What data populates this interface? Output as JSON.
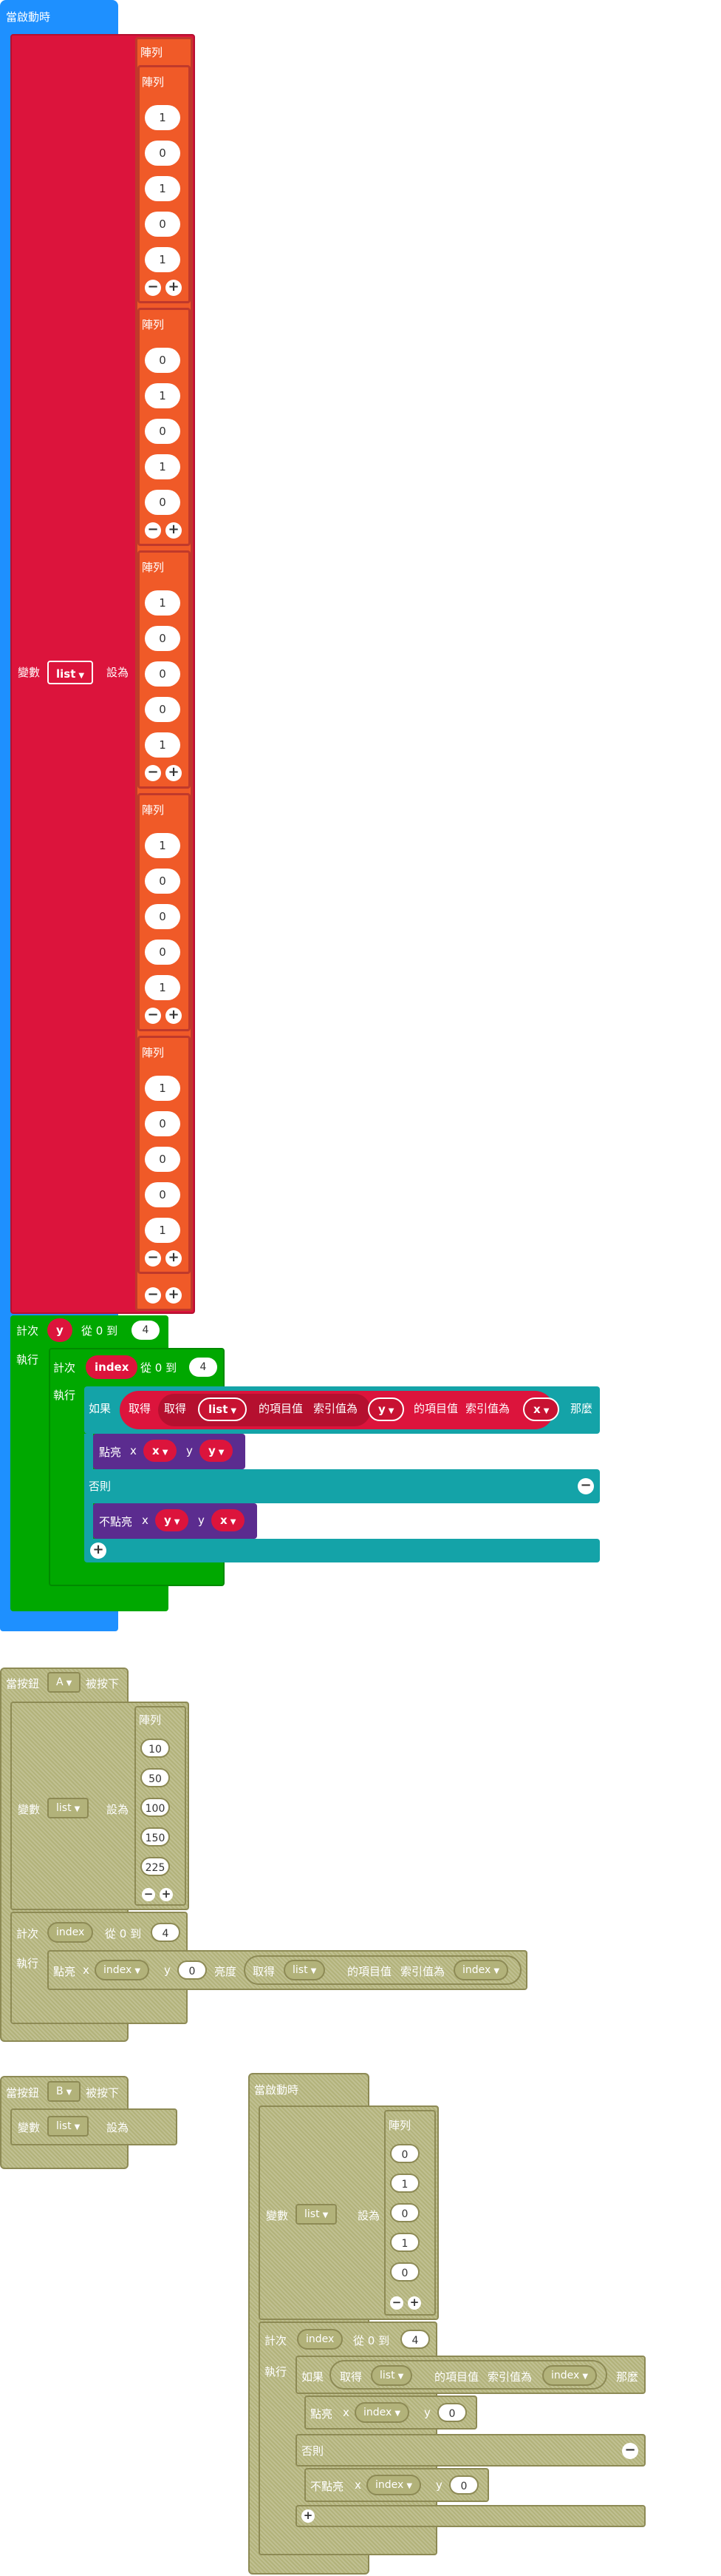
{
  "colors": {
    "start": "#1e90ff",
    "variables": "#dc143c",
    "array": "#f05a28",
    "loops": "#00a800",
    "logic": "#14a3a8",
    "led": "#5b2c8f",
    "disabled": "#b2b27a"
  },
  "stack1": {
    "hat": "當啟動時",
    "set_label": "變數",
    "var_name": "list",
    "set_to": "設為",
    "array_label": "陣列",
    "rows": [
      {
        "label": "陣列",
        "values": [
          "1",
          "0",
          "1",
          "0",
          "1"
        ]
      },
      {
        "label": "陣列",
        "values": [
          "0",
          "1",
          "0",
          "1",
          "0"
        ]
      },
      {
        "label": "陣列",
        "values": [
          "1",
          "0",
          "0",
          "0",
          "1"
        ]
      },
      {
        "label": "陣列",
        "values": [
          "1",
          "0",
          "0",
          "0",
          "1"
        ]
      },
      {
        "label": "陣列",
        "values": [
          "1",
          "0",
          "0",
          "0",
          "1"
        ]
      }
    ],
    "for_label": "計次",
    "from_label": "從 0 到",
    "do_label": "執行",
    "outer_var": "y",
    "outer_to": "4",
    "inner_var": "index",
    "inner_to": "4",
    "if_label": "如果",
    "get_label": "取得",
    "item_label": "的項目值",
    "index_label": "索引值為",
    "then_label": "那麼",
    "list_var": "list",
    "y_var": "y",
    "x_var": "x",
    "else_label": "否則",
    "plot_label": "點亮",
    "unplot_label": "不點亮",
    "x_label": "x",
    "y_label": "y"
  },
  "stack2": {
    "hat": "當按鈕",
    "button": "A",
    "pressed": "被按下",
    "set_label": "變數",
    "var_name": "list",
    "set_to": "設為",
    "array_label": "陣列",
    "values": [
      "10",
      "50",
      "100",
      "150",
      "225"
    ],
    "for_label": "計次",
    "for_var": "index",
    "from_label": "從 0 到",
    "to": "4",
    "do_label": "執行",
    "plot_label": "點亮",
    "x_label": "x",
    "x_var": "index",
    "y_label": "y",
    "y_val": "0",
    "bright_label": "亮度",
    "get_label": "取得",
    "list_var": "list",
    "item_label": "的項目值",
    "index_label": "索引值為",
    "index_var": "index"
  },
  "stack3": {
    "hat": "當按鈕",
    "button": "B",
    "pressed": "被按下",
    "set_label": "變數",
    "var_name": "list",
    "set_to": "設為"
  },
  "stack4": {
    "hat": "當啟動時",
    "set_label": "變數",
    "var_name": "list",
    "set_to": "設為",
    "array_label": "陣列",
    "values": [
      "0",
      "1",
      "0",
      "1",
      "0"
    ],
    "for_label": "計次",
    "for_var": "index",
    "from_label": "從 0 到",
    "to": "4",
    "do_label": "執行",
    "if_label": "如果",
    "get_label": "取得",
    "list_var": "list",
    "item_label": "的項目值",
    "index_label": "索引值為",
    "index_var": "index",
    "then_label": "那麼",
    "plot_label": "點亮",
    "x_label": "x",
    "x_var": "index",
    "y_label": "y",
    "y_val": "0",
    "else_label": "否則",
    "unplot_label": "不點亮"
  },
  "icons": {
    "minus": "−",
    "plus": "+",
    "dropdown": "▼"
  }
}
